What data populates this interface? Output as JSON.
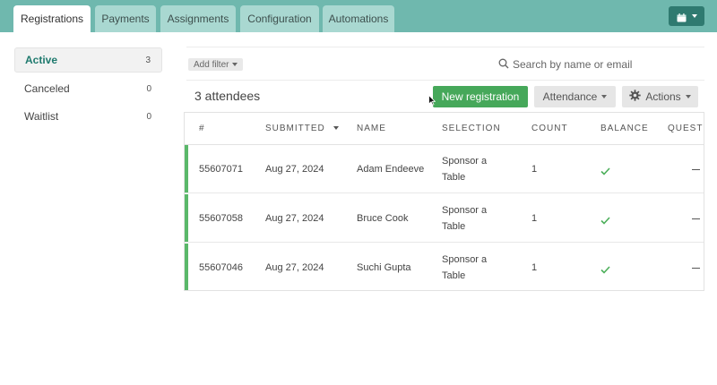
{
  "tabs": [
    {
      "label": "Registrations",
      "active": true
    },
    {
      "label": "Payments",
      "active": false
    },
    {
      "label": "Assignments",
      "active": false
    },
    {
      "label": "Configuration",
      "active": false
    },
    {
      "label": "Automations",
      "active": false
    }
  ],
  "sidebar": {
    "items": [
      {
        "label": "Active",
        "count": "3",
        "active": true
      },
      {
        "label": "Canceled",
        "count": "0",
        "active": false
      },
      {
        "label": "Waitlist",
        "count": "0",
        "active": false
      }
    ]
  },
  "filters": {
    "add_filter_label": "Add filter",
    "search_placeholder": "Search by name or email"
  },
  "summary": {
    "attendee_count_label": "3 attendees"
  },
  "toolbar": {
    "new_registration_label": "New registration",
    "attendance_label": "Attendance",
    "actions_label": "Actions"
  },
  "table": {
    "columns": [
      "#",
      "SUBMITTED",
      "NAME",
      "SELECTION",
      "COUNT",
      "BALANCE",
      "QUESTI"
    ],
    "rows": [
      {
        "id": "55607071",
        "submitted": "Aug 27, 2024",
        "name": "Adam Endeeve",
        "selection_line1": "Sponsor a",
        "selection_line2": "Table",
        "count": "1"
      },
      {
        "id": "55607058",
        "submitted": "Aug 27, 2024",
        "name": "Bruce Cook",
        "selection_line1": "Sponsor a",
        "selection_line2": "Table",
        "count": "1"
      },
      {
        "id": "55607046",
        "submitted": "Aug 27, 2024",
        "name": "Suchi Gupta",
        "selection_line1": "Sponsor a",
        "selection_line2": "Table",
        "count": "1"
      }
    ]
  },
  "colors": {
    "topbar": "#6fb8ae",
    "accent_green": "#46a85a",
    "row_bar": "#5ab86a",
    "active_text": "#1f7a6e"
  },
  "icons": [
    "calendar-icon",
    "search-icon",
    "gear-icon",
    "check-icon",
    "sort-caret-icon"
  ]
}
